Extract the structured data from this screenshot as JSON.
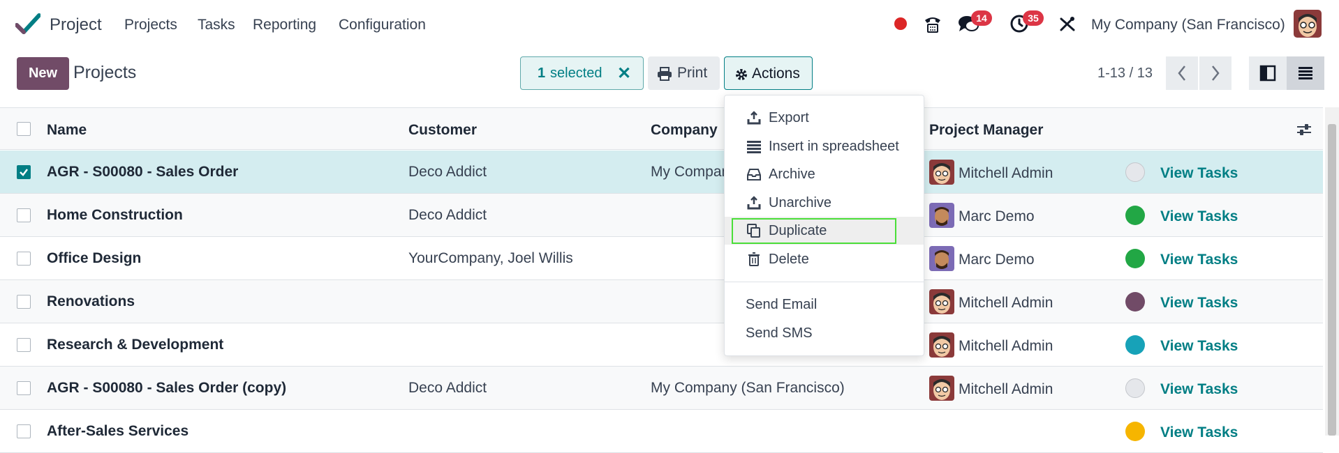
{
  "navbar": {
    "app_name": "Project",
    "menu": [
      "Projects",
      "Tasks",
      "Reporting",
      "Configuration"
    ],
    "chat_count": "14",
    "activity_count": "35",
    "company": "My Company (San Francisco)"
  },
  "control": {
    "new_label": "New",
    "breadcrumb": "Projects",
    "selected_count": "1",
    "selected_label": "selected",
    "clear_symbol": "✕",
    "print_label": "Print",
    "actions_label": "Actions",
    "pager": "1-13 / 13"
  },
  "columns": {
    "name": "Name",
    "customer": "Customer",
    "company": "Company",
    "manager": "Project Manager"
  },
  "rows": [
    {
      "name": "AGR - S00080 - Sales Order",
      "customer": "Deco Addict",
      "company": "My Company (San Francisco)",
      "manager": "Mitchell Admin",
      "status_color": "#e5e7eb",
      "action": "View Tasks",
      "checked": true
    },
    {
      "name": "Home Construction",
      "customer": "Deco Addict",
      "company": "",
      "manager": "Marc Demo",
      "status_color": "#22a745",
      "action": "View Tasks",
      "checked": false
    },
    {
      "name": "Office Design",
      "customer": "YourCompany, Joel Willis",
      "company": "",
      "manager": "Marc Demo",
      "status_color": "#22a745",
      "action": "View Tasks",
      "checked": false
    },
    {
      "name": "Renovations",
      "customer": "",
      "company": "",
      "manager": "Mitchell Admin",
      "status_color": "#714b67",
      "action": "View Tasks",
      "checked": false
    },
    {
      "name": "Research & Development",
      "customer": "",
      "company": "",
      "manager": "Mitchell Admin",
      "status_color": "#17a2b8",
      "action": "View Tasks",
      "checked": false
    },
    {
      "name": "AGR - S00080 - Sales Order (copy)",
      "customer": "Deco Addict",
      "company": "My Company (San Francisco)",
      "manager": "Mitchell Admin",
      "status_color": "#e5e7eb",
      "action": "View Tasks",
      "checked": false
    },
    {
      "name": "After-Sales Services",
      "customer": "",
      "company": "",
      "manager": "",
      "status_color": "#f6b500",
      "action": "View Tasks",
      "checked": false
    }
  ],
  "dropdown": {
    "items": [
      "Export",
      "Insert in spreadsheet",
      "Archive",
      "Unarchive",
      "Duplicate",
      "Delete"
    ],
    "extra": [
      "Send Email",
      "Send SMS"
    ],
    "highlighted": "Duplicate"
  },
  "colors": {
    "brand": "#714b67",
    "accent": "#017e84",
    "selected_row": "#d4edf0",
    "badge": "#dc3545"
  },
  "icons": [
    "odoo-check-logo",
    "record-dot-icon",
    "phone-icon",
    "chat-icon",
    "clock-icon",
    "tools-icon",
    "user-avatar",
    "print-icon",
    "gear-icon",
    "chevron-left-icon",
    "chevron-right-icon",
    "kanban-view-icon",
    "list-view-icon",
    "column-settings-icon",
    "export-icon",
    "spreadsheet-icon",
    "archive-icon",
    "unarchive-icon",
    "duplicate-icon",
    "trash-icon"
  ]
}
